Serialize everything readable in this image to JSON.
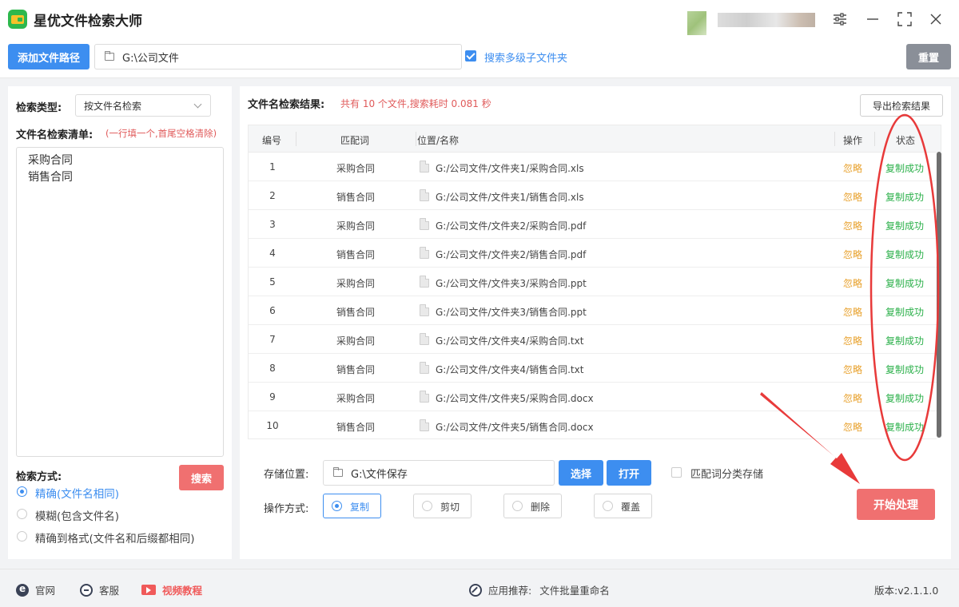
{
  "app": {
    "title": "星优文件检索大师"
  },
  "toolbar": {
    "add_path_label": "添加文件路径",
    "path_value": "G:\\公司文件",
    "search_subfolders_label": "搜索多级子文件夹",
    "search_subfolders_checked": true,
    "reset_label": "重置"
  },
  "left": {
    "search_type_label": "检索类型:",
    "search_type_value": "按文件名检索",
    "list_label": "文件名检索清单:",
    "list_hint": "(一行填一个,首尾空格清除)",
    "list_items": [
      "采购合同",
      "销售合同"
    ],
    "search_mode_label": "检索方式:",
    "search_button": "搜索",
    "modes": [
      {
        "label": "精确(文件名相同)",
        "selected": true
      },
      {
        "label": "模糊(包含文件名)",
        "selected": false
      },
      {
        "label": "精确到格式(文件名和后缀都相同)",
        "selected": false
      }
    ]
  },
  "results": {
    "title": "文件名检索结果:",
    "summary": "共有 10 个文件,搜索耗时 0.081 秒",
    "export_label": "导出检索结果",
    "columns": [
      "编号",
      "匹配词",
      "位置/名称",
      "操作",
      "状态"
    ],
    "rows": [
      {
        "num": "1",
        "keyword": "采购合同",
        "path": "G:/公司文件/文件夹1/采购合同.xls",
        "op": "忽略",
        "status": "复制成功"
      },
      {
        "num": "2",
        "keyword": "销售合同",
        "path": "G:/公司文件/文件夹1/销售合同.xls",
        "op": "忽略",
        "status": "复制成功"
      },
      {
        "num": "3",
        "keyword": "采购合同",
        "path": "G:/公司文件/文件夹2/采购合同.pdf",
        "op": "忽略",
        "status": "复制成功"
      },
      {
        "num": "4",
        "keyword": "销售合同",
        "path": "G:/公司文件/文件夹2/销售合同.pdf",
        "op": "忽略",
        "status": "复制成功"
      },
      {
        "num": "5",
        "keyword": "采购合同",
        "path": "G:/公司文件/文件夹3/采购合同.ppt",
        "op": "忽略",
        "status": "复制成功"
      },
      {
        "num": "6",
        "keyword": "销售合同",
        "path": "G:/公司文件/文件夹3/销售合同.ppt",
        "op": "忽略",
        "status": "复制成功"
      },
      {
        "num": "7",
        "keyword": "采购合同",
        "path": "G:/公司文件/文件夹4/采购合同.txt",
        "op": "忽略",
        "status": "复制成功"
      },
      {
        "num": "8",
        "keyword": "销售合同",
        "path": "G:/公司文件/文件夹4/销售合同.txt",
        "op": "忽略",
        "status": "复制成功"
      },
      {
        "num": "9",
        "keyword": "采购合同",
        "path": "G:/公司文件/文件夹5/采购合同.docx",
        "op": "忽略",
        "status": "复制成功"
      },
      {
        "num": "10",
        "keyword": "销售合同",
        "path": "G:/公司文件/文件夹5/销售合同.docx",
        "op": "忽略",
        "status": "复制成功"
      }
    ]
  },
  "storage": {
    "label": "存储位置:",
    "value": "G:\\文件保存",
    "choose_label": "选择",
    "open_label": "打开",
    "classify_label": "匹配词分类存储",
    "classify_checked": false
  },
  "operation": {
    "label": "操作方式:",
    "options": [
      {
        "label": "复制",
        "selected": true
      },
      {
        "label": "剪切",
        "selected": false
      },
      {
        "label": "删除",
        "selected": false
      },
      {
        "label": "覆盖",
        "selected": false
      }
    ],
    "start_label": "开始处理"
  },
  "footer": {
    "website": "官网",
    "support": "客服",
    "video": "视频教程",
    "recommend_label": "应用推荐:",
    "recommend_app": "文件批量重命名",
    "version": "版本:v2.1.1.0"
  },
  "colors": {
    "accent": "#3d8ef0",
    "danger": "#f07070",
    "success": "#2bb04a",
    "warning": "#e8a02a",
    "annotation": "#e83a3a"
  }
}
